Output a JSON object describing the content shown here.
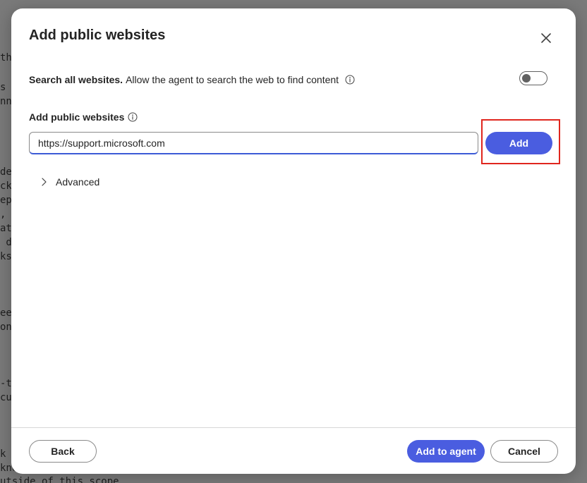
{
  "background_fragments": [
    "th",
    "s",
    "nn",
    "de",
    "ck",
    "ep",
    ",",
    "at",
    " d",
    "ks",
    "ee",
    "on",
    "-t",
    "cu",
    "k",
    "kno",
    "utside of this scope"
  ],
  "dialog": {
    "title": "Add public websites",
    "close_icon": "close-icon",
    "search_all": {
      "label_bold": "Search all websites.",
      "label_text": "Allow the agent to search the web to find content",
      "info_icon": "info-icon",
      "toggle_on": false
    },
    "websites": {
      "label": "Add public websites",
      "info_icon": "info-icon",
      "input_value": "https://support.microsoft.com",
      "add_label": "Add"
    },
    "advanced": {
      "label": "Advanced",
      "icon": "chevron-right-icon",
      "expanded": false
    },
    "footer": {
      "back_label": "Back",
      "add_to_agent_label": "Add to agent",
      "cancel_label": "Cancel"
    }
  },
  "colors": {
    "accent": "#4a5de0",
    "highlight": "#e0261e",
    "text": "#242424"
  }
}
